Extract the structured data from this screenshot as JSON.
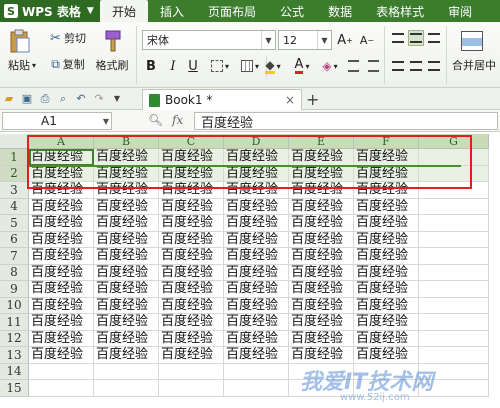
{
  "app": {
    "name": "WPS 表格"
  },
  "menu": [
    "开始",
    "插入",
    "页面布局",
    "公式",
    "数据",
    "表格样式",
    "审阅"
  ],
  "active_menu": 0,
  "ribbon": {
    "paste": "粘贴",
    "cut": "剪切",
    "copy": "复制",
    "format_painter": "格式刷",
    "font_name": "宋体",
    "font_size": "12",
    "bold": "B",
    "italic": "I",
    "underline": "U",
    "merge_center": "合并居中"
  },
  "tab": {
    "name": "Book1 *"
  },
  "formula": {
    "cell_ref": "A1",
    "fx_label": "fx",
    "content": "百度经验"
  },
  "columns": [
    "A",
    "B",
    "C",
    "D",
    "E",
    "F",
    "G"
  ],
  "rows": [
    "1",
    "2",
    "3",
    "4",
    "5",
    "6",
    "7",
    "8",
    "9",
    "10",
    "11",
    "12",
    "13",
    "14",
    "15"
  ],
  "cell_text": "百度经验",
  "filled_cols": 6,
  "filled_rows": 13,
  "watermark": "我爱IT技术网",
  "watermark_url": "www.52ij.com"
}
